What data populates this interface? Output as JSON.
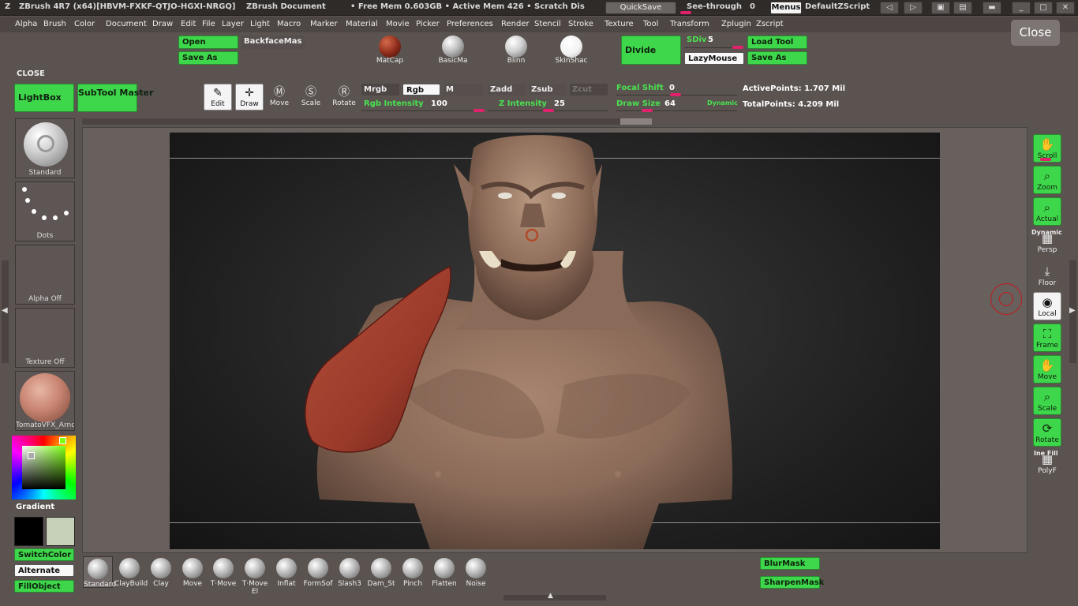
{
  "titlebar": {
    "app": "ZBrush 4R7 (x64)[HBVM-FXKF-QTJO-HGXI-NRGQ]",
    "document": "ZBrush Document",
    "memory": "• Free Mem 0.603GB • Active Mem 426 • Scratch Dis",
    "quicksave": "QuickSave",
    "see_through_label": "See-through",
    "see_through_value": "0",
    "menus": "Menus",
    "default_script": "DefaultZScript"
  },
  "menu": [
    "Alpha",
    "Brush",
    "Color",
    "Document",
    "Draw",
    "Edit",
    "File",
    "Layer",
    "Light",
    "Macro",
    "Marker",
    "Material",
    "Movie",
    "Picker",
    "Preferences",
    "Render",
    "Stencil",
    "Stroke",
    "Texture",
    "Tool",
    "Transform",
    "Zplugin",
    "Zscript"
  ],
  "close_button": "Close",
  "top_tools": {
    "open": "Open",
    "save_as": "Save As",
    "backface_mask": "BackfaceMas",
    "close_label": "CLOSE",
    "materials": [
      {
        "name": "MatCap",
        "color": "#8b2a1a"
      },
      {
        "name": "BasicMa",
        "color": "#bdbdbd"
      },
      {
        "name": "Blinn",
        "color": "#cfcfcf"
      },
      {
        "name": "SkinShac",
        "color": "#f2f2f2"
      }
    ],
    "divide": "Divide",
    "sdiv_label": "SDiv",
    "sdiv_value": "5",
    "lazymouse": "LazyMouse",
    "load_tool": "Load Tool",
    "save_as2": "Save As"
  },
  "left_top": {
    "lightbox": "LightBox",
    "subtool_master": "SubTool Master"
  },
  "draw_modes": [
    {
      "label": "Edit",
      "glyph": "✎",
      "icon": "edit-icon",
      "selected": true
    },
    {
      "label": "Draw",
      "glyph": "✛",
      "icon": "draw-icon",
      "selected": true
    },
    {
      "label": "Move",
      "glyph": "M",
      "icon": "move-icon",
      "selected": false
    },
    {
      "label": "Scale",
      "glyph": "S",
      "icon": "scale-icon",
      "selected": false
    },
    {
      "label": "Rotate",
      "glyph": "R",
      "icon": "rotate-icon",
      "selected": false
    }
  ],
  "brush_settings": {
    "mrgb": "Mrgb",
    "rgb": "Rgb",
    "m": "M",
    "zadd": "Zadd",
    "zsub": "Zsub",
    "zcut": "Zcut",
    "rgb_intensity_label": "Rgb Intensity",
    "rgb_intensity_value": "100",
    "z_intensity_label": "Z Intensity",
    "z_intensity_value": "25",
    "focal_shift_label": "Focal Shift",
    "focal_shift_value": "0",
    "draw_size_label": "Draw Size",
    "draw_size_value": "64",
    "dynamic": "Dynamic"
  },
  "stats": {
    "active_points": "ActivePoints: 1.707 Mil",
    "total_points": "TotalPoints: 4.209 Mil"
  },
  "left_tray": {
    "brush": "Standard",
    "stroke": "Dots",
    "alpha": "Alpha Off",
    "texture": "Texture Off",
    "material": "TomatoVFX_Arnc",
    "gradient": "Gradient",
    "switch_color": "SwitchColor",
    "alternate": "Alternate",
    "fill_object": "FillObject",
    "main_color": "#000000",
    "secondary_color": "#c7d1b9"
  },
  "right_shelf": [
    {
      "label": "Scroll",
      "glyph": "✋",
      "icon": "scroll-icon",
      "style": "green"
    },
    {
      "label": "Zoom",
      "glyph": "🔍",
      "icon": "zoom-icon",
      "style": "green"
    },
    {
      "label": "Actual",
      "glyph": "🔍",
      "icon": "actual-icon",
      "style": "green"
    },
    {
      "label": "Persp",
      "glyph": "▦",
      "icon": "persp-icon",
      "style": "plain",
      "above": "Dynamic"
    },
    {
      "label": "Floor",
      "glyph": "⤓",
      "icon": "floor-icon",
      "style": "plain"
    },
    {
      "label": "Local",
      "glyph": "◉",
      "icon": "local-icon",
      "style": "white"
    },
    {
      "label": "Frame",
      "glyph": "⛶",
      "icon": "frame-icon",
      "style": "green"
    },
    {
      "label": "Move",
      "glyph": "✋",
      "icon": "move-view-icon",
      "style": "green"
    },
    {
      "label": "Scale",
      "glyph": "🔍",
      "icon": "scale-view-icon",
      "style": "green"
    },
    {
      "label": "Rotate",
      "glyph": "⟳",
      "icon": "rotate-view-icon",
      "style": "green"
    },
    {
      "label": "PolyF",
      "glyph": "▦",
      "icon": "polyf-icon",
      "style": "plain",
      "above": "Ine Fill"
    }
  ],
  "bottom_brushes": [
    "Standard",
    "ClayBuild",
    "Clay",
    "Move",
    "T·Move",
    "T·Move El",
    "Inflat",
    "FormSof",
    "Slash3",
    "Dam_St",
    "Pinch",
    "Flatten",
    "Noise"
  ],
  "bottom_right": {
    "blur_mask": "BlurMask",
    "sharpen_mask": "SharpenMask"
  }
}
